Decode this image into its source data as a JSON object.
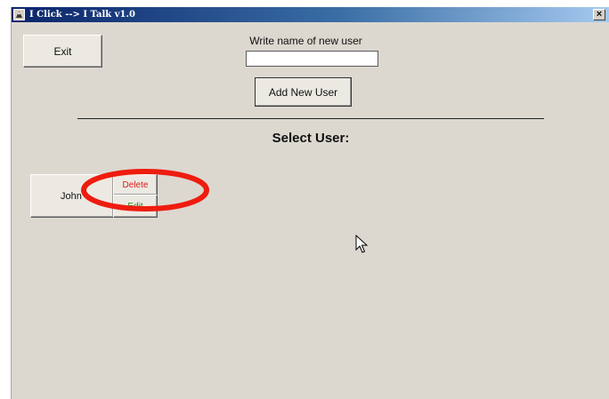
{
  "window": {
    "title": "I Click --> I Talk v1.0",
    "close_label": "×"
  },
  "controls": {
    "exit_label": "Exit",
    "new_user_label": "Write name of new user",
    "new_user_value": "",
    "add_user_label": "Add New User"
  },
  "users_section": {
    "heading": "Select User:",
    "users": [
      {
        "name": "John",
        "delete_label": "Delete",
        "edit_label": "Edit"
      }
    ]
  },
  "colors": {
    "delete": "#d81b1b",
    "edit": "#1e8e1e",
    "annotation": "#ee1c0f",
    "window_bg": "#dcd8d0"
  },
  "icons": [
    "app-icon",
    "close-icon",
    "mouse-cursor-icon"
  ]
}
